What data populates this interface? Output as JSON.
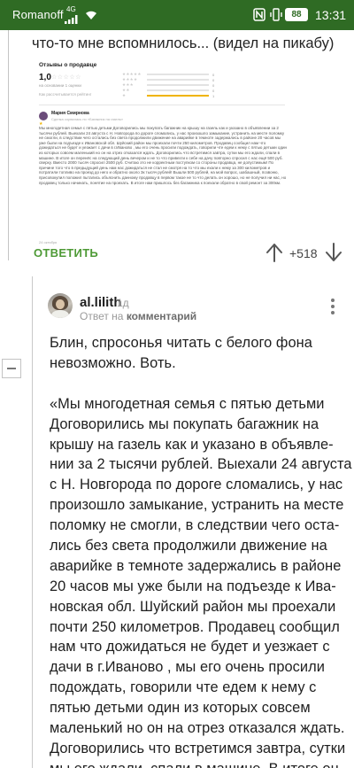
{
  "status_bar": {
    "carrier": "Romanoff",
    "network": "4G",
    "battery": "88",
    "time": "13:31"
  },
  "previous_comment": {
    "text_tail": "что-то мне вспомнилось... (видел на пикабу)",
    "screenshot": {
      "title": "Отзывы о продавце",
      "score": "1,0",
      "based_on": "на основании 1 оценки",
      "recalc_note": "Как рассчитывается рейтинг",
      "rating_rows": [
        {
          "stars": "★★★★★",
          "count": "0",
          "fill": 0
        },
        {
          "stars": "★★★★",
          "count": "0",
          "fill": 0
        },
        {
          "stars": "★★★",
          "count": "0",
          "fill": 0
        },
        {
          "stars": "★★",
          "count": "0",
          "fill": 0
        },
        {
          "stars": "★",
          "count": "1",
          "fill": 1
        }
      ],
      "review": {
        "author": "Мария Смирнова",
        "meta": "Сделка сорвалась по «Багажник на газель»",
        "stars": "★",
        "body": "Мы многодетная семья с пятью детьми Договорились мы покупать багажник на крышу на газель как и указано в объявлении за 2 тысячи рублей. Выехали 24 августа с Н. Новгорода по дороге сломались, у нас произошло замыкание, устранить на месте поломку не смогли, в следствии чего остались без света продолжили движение на аварийке в темноте задержались в районе 20 часов мы уже были на подъезде к Ивановской обл. Шуйский район мы проехали почти 250 километров. Продавец сообщил нам что дожидаться не будет и уезжает с дачи в г.Иваново , мы его очень просили подождать, говорили чте едем к нему с пятью детьми один из которых совсем маленький но он на отрез отказался ждать. Договорились что встретимся завтра, сутки мы его ждали, спали в машине. В итоге он перенёс на следующий день вечером и не то что привезти к себе на дачу повторно спросил с нас ещё 500 руб. сверху. Вместо 2000 тысяч спросил 2500 руб. Считаю это не корректным поступком со стороны продавца, не допустимым! По причине того что в предыдущий день нам нас дожидаться не стал не смотря на то что мы ехали к нему за 300 километров и потратили топливо на проезд до него и обратно около 3к тысяч рублей! Вышли 500 рублей, на мой вопрос, шабашный, позвоню, присовокупил положил пытались объяснить данному продавцу в первом такое не то что делать он хорошо, но не получил ни нас, но продавец только начинать, понятие на проехать. В итоге нам пришлось без багажника к поехали обратно в свой ремонт за 300км.",
        "date": "24 октября"
      }
    },
    "reply_label": "ОТВЕТИТЬ",
    "rating": "+518"
  },
  "comment": {
    "username": "al.lilith",
    "time_ago": "1д",
    "reply_prefix": "Ответ на",
    "reply_target": "комментарий",
    "lines_para1": [
      "Блин, спросонья читать с белого фона",
      "невозможно. Воть."
    ],
    "lines_para2": [
      "«Мы многодетная семья с пятью детьми",
      "Договорились мы покупать багажник на",
      "крышу на газель как и указано в объявле-",
      "нии за 2 тысячи рублей. Выехали 24 августа",
      "с Н. Новгорода по дороге сломались, у нас",
      "произошло замыкание, устранить на месте",
      "поломку не смогли, в следствии чего оста-",
      "лись без света продолжили движение на",
      "аварийке в темноте задержались в районе",
      "20 часов мы уже были на подъезде к Ива-",
      "новская обл. Шуйский район мы проехали",
      "почти 250 километров. Продавец сообщил",
      "нам что дожидаться не будет и уезжает с",
      "дачи в г.Иваново , мы его очень просили",
      "подождать, говорили чте едем к нему с",
      "пятью детьми один из которых совсем",
      "маленький но он на отрез отказался ждать.",
      "Договорились что встретимся завтра, сутки",
      "мы его ждали, спали в машине. В итоге он"
    ]
  }
}
